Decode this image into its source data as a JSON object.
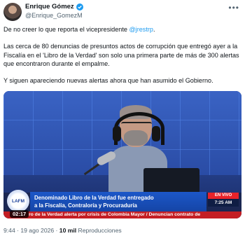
{
  "author": {
    "name": "Enrique Gómez",
    "handle": "@Enrique_GomezM"
  },
  "more_icon": "•••",
  "tweet": {
    "line1_pre": "De no creer lo que reporta el vicepresidente ",
    "line1_mention": "@jrestrp",
    "line1_post": ".",
    "para2": "Las cerca de 80 denuncias de presuntos actos de corrupción que entregó ayer a la Fiscalía en el 'Libro de la Verdad' son solo una primera parte de más de 300 alertas que encontraron durante el empalme.",
    "para3": "Y siguen apareciendo nuevas alertas ahora que han asumido el Gobierno."
  },
  "video": {
    "live_label": "EN VIVO",
    "live_time": "7:25 AM",
    "logo_text": "LAFM",
    "headline_line1": "Denominado Libro de la Verdad fue entregado",
    "headline_line2": "a la Fiscalía, Contraloría y Procuraduría",
    "ticker": "ro de la Verdad alerta por crisis de Colombia Mayor / Denuncian contrato de",
    "timecode": "02:17"
  },
  "footer": {
    "time_date": "9:44 · 19 ago 2026 · ",
    "views_count": "10 mil",
    "views_label": " Reproducciones"
  },
  "colors": {
    "accent": "#1d9bf0",
    "ticker_red": "#c41e24",
    "headline_blue": "#1c57c8"
  }
}
